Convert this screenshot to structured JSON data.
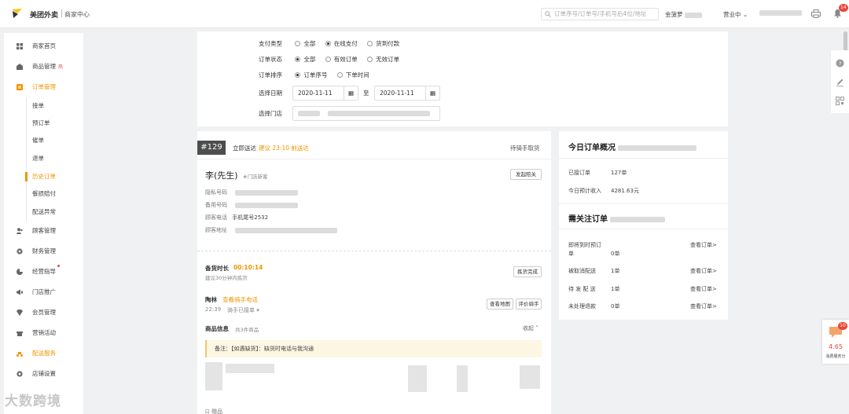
{
  "topbar": {
    "brand": "美团外卖",
    "brand_sub": "商家中心",
    "search_placeholder": "订单序号/订单号/手机号后4位/地址",
    "user": "金菠萝",
    "status": "营业中",
    "bell_count": "14"
  },
  "sidebar": {
    "items": [
      {
        "label": "商家首页",
        "icon": "home-icon"
      },
      {
        "label": "商品管理",
        "icon": "goods-icon",
        "tag": "热"
      },
      {
        "label": "订单管理",
        "icon": "order-icon"
      },
      {
        "label": "顾客管理",
        "icon": "customer-icon"
      },
      {
        "label": "财务管理",
        "icon": "finance-icon"
      },
      {
        "label": "经营指导",
        "icon": "guide-icon"
      },
      {
        "label": "门店推广",
        "icon": "promo-icon"
      },
      {
        "label": "会员管理",
        "icon": "member-icon"
      },
      {
        "label": "营销活动",
        "icon": "marketing-icon"
      },
      {
        "label": "配送服务",
        "icon": "delivery-icon"
      },
      {
        "label": "店铺设置",
        "icon": "settings-icon"
      }
    ],
    "order_sub": [
      "接单",
      "预订单",
      "催单",
      "退单",
      "历史订单",
      "餐损赔付",
      "配送异常"
    ]
  },
  "filter": {
    "pay_label": "支付类型",
    "pay_options": [
      "全部",
      "在线支付",
      "货到付款"
    ],
    "status_label": "订单状态",
    "status_options": [
      "全部",
      "有效订单",
      "无效订单"
    ],
    "sort_label": "订单排序",
    "sort_options": [
      "订单序号",
      "下单时间"
    ],
    "date_label": "选择日期",
    "date_from": "2020-11-11",
    "date_sep": "至",
    "date_to": "2020-11-11",
    "shop_label": "选择门店"
  },
  "order": {
    "number": "#129",
    "delivery": "立即送达",
    "suggest": "建议 23:10 前送达",
    "rider_state": "待骑手取货",
    "customer": "李(先生)",
    "customer_tag": "#门店新客",
    "dispute_btn": "发起赔关",
    "privacy_label": "隐私号码",
    "backup_label": "备用号码",
    "phone_label": "顾客电话",
    "phone_value": "手机尾号2532",
    "address_label": "顾客地址",
    "prep_label": "备货时长",
    "prep_time": "00:10:14",
    "prep_hint": "建议30分钟内拣货",
    "prep_done_btn": "拣货完成",
    "rider_name": "陶林",
    "rider_link": "查看骑手电话",
    "rider_time": "22:39",
    "rider_status": "骑手已接单",
    "map_btn": "查看地图",
    "rate_btn": "评价骑手",
    "goods_label": "商品信息",
    "goods_count": "共3件商品",
    "collapse": "收起",
    "note": "备注：【如遇缺货】：缺货时电话与我沟通",
    "bottom_label": "赠品"
  },
  "summary": {
    "title": "今日订单概况",
    "received_label": "已接订单",
    "received_value": "127单",
    "income_label": "今日预计收入",
    "income_value": "4281.63元",
    "attention_title": "需关注订单",
    "rows": [
      {
        "label": "即将到时预订单",
        "value": "0单",
        "link": "查看订单>"
      },
      {
        "label": "被取消配送",
        "value": "1单",
        "link": "查看订单>"
      },
      {
        "label": "待 发 配 送",
        "value": "1单",
        "link": "查看订单>"
      },
      {
        "label": "未处理退款",
        "value": "0单",
        "link": "查看订单>"
      }
    ]
  },
  "score": {
    "badge": "10",
    "value": "4.65",
    "label": "消费服务分"
  },
  "watermark": "大数跨境",
  "colors": {
    "accent": "#f29400",
    "badge": "#e8473b"
  }
}
